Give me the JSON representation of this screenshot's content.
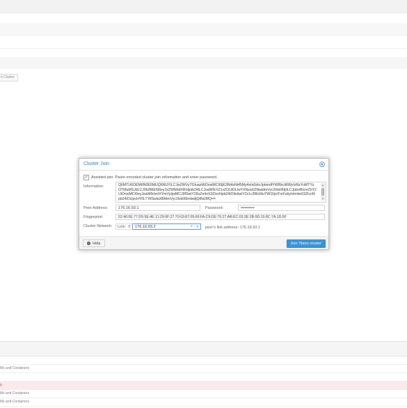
{
  "background": {
    "tab_label": "e Cluster",
    "rows": [
      {
        "text": "",
        "error": false
      },
      {
        "text": "Ms and Containers",
        "error": false
      },
      {
        "text": "",
        "error": false
      },
      {
        "text": "p",
        "error": true
      },
      {
        "text": "Ms and Containers",
        "error": false
      },
      {
        "text": "Ms and Containers",
        "error": false
      }
    ]
  },
  "dialog": {
    "title": "Cluster Join",
    "assisted_join": {
      "checked": true,
      "check_mark": "✓",
      "label": "Assisted join: Paste encoded cluster join information and enter password."
    },
    "information": {
      "label": "Information:",
      "value": "Q6MTU6OEM6N0E6MUQ6NUYiLCJwZWVyTGluazMiOnsiMCI6IjE3Ni4xNi45My4xIn0sInJpbmdfYWRkciI6WyIxNzYuMTYuOTMuMSJdLCJ0b3RlbSI6eyJzZWNhdXRoIjoib24iLCJsaW5rX21vZGUiOiJwYXNzaXZlIiwidmVyc2lvbiI6IjIiLCJpbnRlcmZhY2UiOnsiMCI6eyJsaW5rbnVtYmVyIjoiMCJ9fSwiY29uZmlnX3ZlcnNpb24iOiIxIiwiY2x1c3Rlcl9uYW1lIjoiTmFubyIsImlwX3ZlcnNpb24iOiJpcHY0LTYifSwiaXBfdmVyc2lvbiI6ImlwdjQtNiJ9fQ=="
    },
    "peer_address": {
      "label": "Peer Address:",
      "value": "176.16.93.1"
    },
    "password": {
      "label": "Password:",
      "value": "••••••••••"
    },
    "fingerprint": {
      "label": "Fingerprint:",
      "value": "52:46:5E:77:D5:5E:4E:11:29:0F:27:70:03:87:05:69:FA:C9:DE:75:27:AB:EC:03:3E:2B:9D:15:8C:7A:1D:5F"
    },
    "cluster_network": {
      "label": "Cluster Network:",
      "link_label": "Link:",
      "link_number": "0",
      "selected": "176.16.93.2",
      "clear_glyph": "×",
      "arrow_glyph": "▾",
      "peer_link": "peer's link address: 176.16.93.1"
    },
    "help_button": {
      "label": "Help",
      "icon": "question-circle-icon",
      "glyph": "?"
    },
    "join_button": {
      "label": "Join 'Nano-cluster'"
    },
    "close_icon": "close-circle-icon",
    "colors": {
      "title": "#2679b8",
      "accent": "#3892d4",
      "focus": "#4a90d9"
    }
  }
}
